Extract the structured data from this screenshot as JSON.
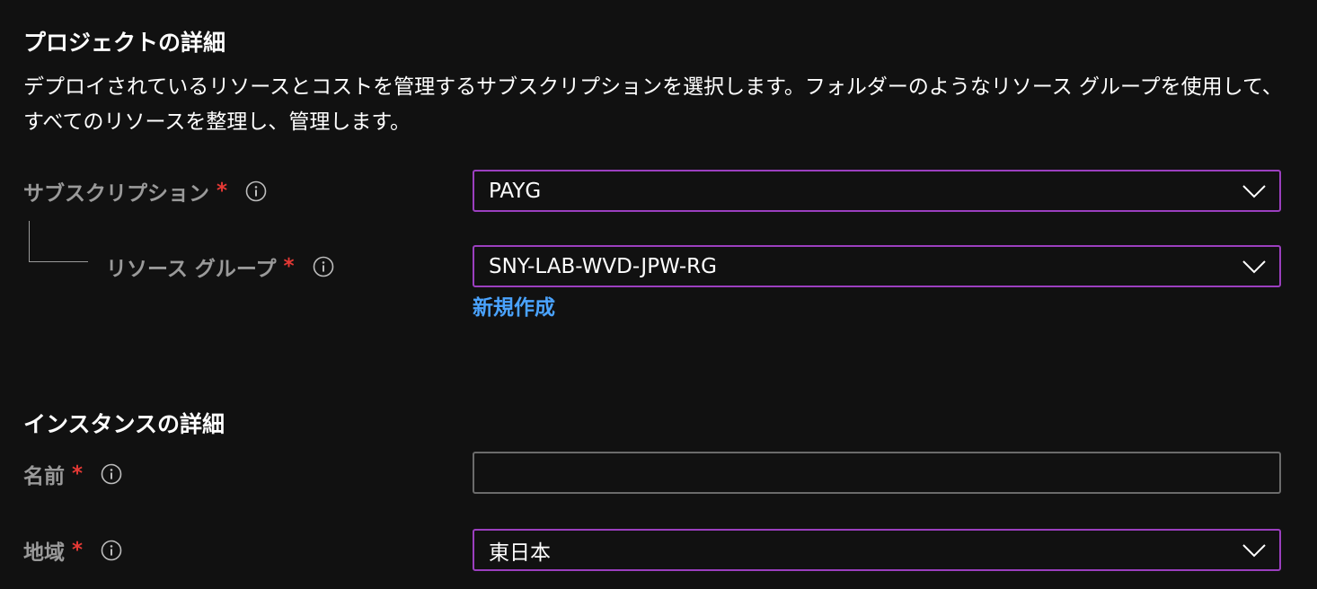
{
  "project": {
    "title": "プロジェクトの詳細",
    "description": "デプロイされているリソースとコストを管理するサブスクリプションを選択します。フォルダーのようなリソース グループを使用して、すべてのリソースを整理し、管理します。"
  },
  "subscription": {
    "label": "サブスクリプション",
    "required": "*",
    "value": "PAYG"
  },
  "resource_group": {
    "label": "リソース グループ",
    "required": "*",
    "value": "SNY-LAB-WVD-JPW-RG",
    "create_new_link": "新規作成"
  },
  "instance": {
    "title": "インスタンスの詳細"
  },
  "name_field": {
    "label": "名前",
    "required": "*",
    "value": ""
  },
  "region": {
    "label": "地域",
    "required": "*",
    "value": "東日本"
  },
  "icons": {
    "info": "info-icon",
    "dropdown": "chevron-down-icon"
  },
  "colors": {
    "background": "#111111",
    "focus_border": "#9b3fbf",
    "input_border": "#6b6b6b",
    "required": "#e53935",
    "link": "#4aa3ff",
    "label": "#9a9a9a"
  }
}
